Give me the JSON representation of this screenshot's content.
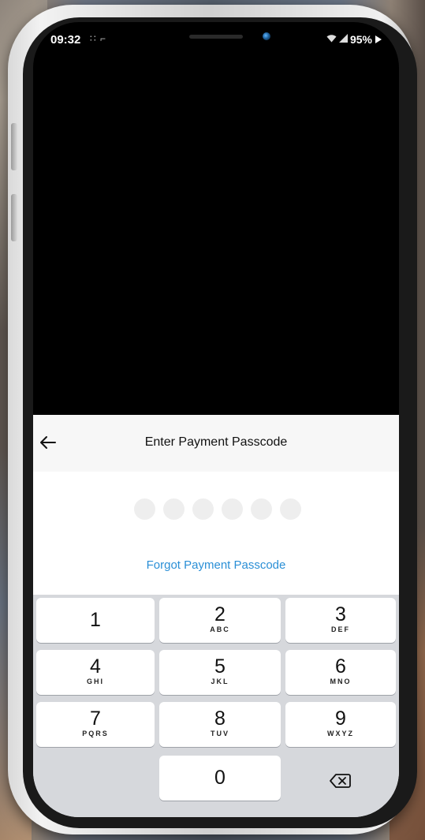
{
  "status_bar": {
    "time": "09:32",
    "extra_icons": "∷ ⌐",
    "battery": "95%"
  },
  "sheet": {
    "title": "Enter Payment Passcode",
    "forgot_link": "Forgot Payment Passcode",
    "passcode_length": 6
  },
  "keypad": {
    "keys": [
      {
        "num": "1",
        "letters": ""
      },
      {
        "num": "2",
        "letters": "ABC"
      },
      {
        "num": "3",
        "letters": "DEF"
      },
      {
        "num": "4",
        "letters": "GHI"
      },
      {
        "num": "5",
        "letters": "JKL"
      },
      {
        "num": "6",
        "letters": "MNO"
      },
      {
        "num": "7",
        "letters": "PQRS"
      },
      {
        "num": "8",
        "letters": "TUV"
      },
      {
        "num": "9",
        "letters": "WXYZ"
      },
      {
        "num": "0",
        "letters": ""
      }
    ]
  },
  "icons": {
    "back": "back-arrow-icon",
    "backspace": "backspace-icon",
    "wifi": "wifi-icon",
    "signal": "signal-icon",
    "battery": "battery-icon"
  },
  "colors": {
    "link": "#2a8fd6",
    "keypad_bg": "#d6d8dc",
    "dot": "#eeeeee"
  }
}
